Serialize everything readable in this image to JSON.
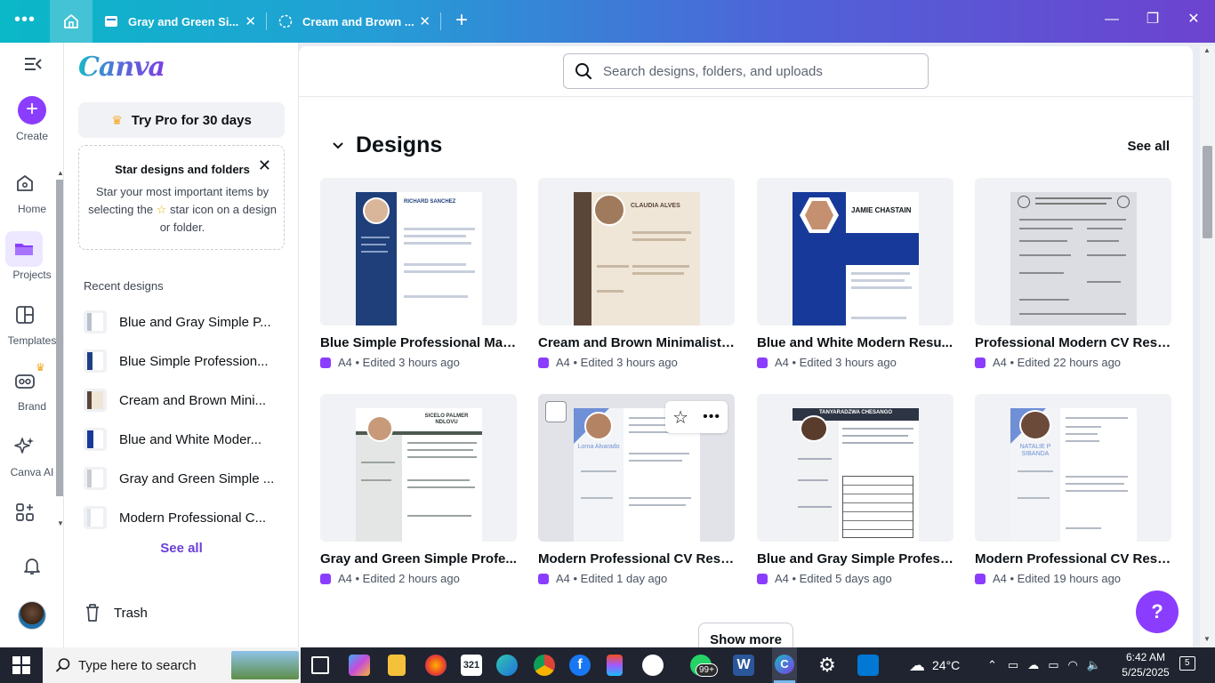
{
  "browser": {
    "tabs": [
      {
        "label": "Gray and Green Si..."
      },
      {
        "label": "Cream and Brown ..."
      }
    ]
  },
  "rail": {
    "create": "Create",
    "home": "Home",
    "projects": "Projects",
    "templates": "Templates",
    "brand": "Brand",
    "canva_ai": "Canva AI"
  },
  "panel": {
    "logo": "Canva",
    "pro_button": "Try Pro for 30 days",
    "star_card": {
      "title": "Star designs and folders",
      "body_before": "Star your most important items by selecting the",
      "body_after": "star icon on a design or folder."
    },
    "recent_title": "Recent designs",
    "recent": [
      {
        "label": "Blue and Gray Simple P..."
      },
      {
        "label": "Blue Simple Profession..."
      },
      {
        "label": "Cream and Brown Mini..."
      },
      {
        "label": "Blue and White Moder..."
      },
      {
        "label": "Gray and Green Simple ..."
      },
      {
        "label": "Modern Professional C..."
      }
    ],
    "see_all": "See all",
    "trash": "Trash"
  },
  "main": {
    "search_placeholder": "Search designs, folders, and uploads",
    "section_title": "Designs",
    "see_all": "See all",
    "designs": [
      {
        "title": "Blue Simple Professional Mar...",
        "meta": "A4 • Edited 3 hours ago",
        "thumb_name": "richard-sanchez-resume",
        "thumb_heading": "RICHARD SANCHEZ"
      },
      {
        "title": "Cream and Brown Minimalist ...",
        "meta": "A4 • Edited 3 hours ago",
        "thumb_name": "claudia-alves-resume",
        "thumb_heading": "CLAUDIA ALVES"
      },
      {
        "title": "Blue and White Modern Resu...",
        "meta": "A4 • Edited 3 hours ago",
        "thumb_name": "jamie-chastain-resume",
        "thumb_heading": "JAMIE CHASTAIN"
      },
      {
        "title": "Professional Modern CV Resu...",
        "meta": "A4 • Edited 22 hours ago",
        "thumb_name": "scanned-document",
        "thumb_heading": ""
      },
      {
        "title": "Gray and Green Simple Profe...",
        "meta": "A4 • Edited 2 hours ago",
        "thumb_name": "sicelo-palmer-resume",
        "thumb_heading": "SICELO PALMER NDLOVU"
      },
      {
        "title": "Modern Professional CV Resu...",
        "meta": "A4 • Edited 1 day ago",
        "thumb_name": "lorna-alvarado-resume",
        "thumb_heading": "Lorna Alvarado"
      },
      {
        "title": "Blue and Gray Simple Profess...",
        "meta": "A4 • Edited 5 days ago",
        "thumb_name": "tanyaradzwa-chesango-resume",
        "thumb_heading": "TANYARADZWA CHESANGO"
      },
      {
        "title": "Modern Professional CV Resu...",
        "meta": "A4 • Edited 19 hours ago",
        "thumb_name": "natalie-sibanda-resume",
        "thumb_heading": "NATALIE P SIBANDA"
      }
    ],
    "show_more": "Show more",
    "help": "?"
  },
  "taskbar": {
    "search_placeholder": "Type here to search",
    "weather": "24°C",
    "time": "6:42 AM",
    "date": "5/25/2025",
    "notif_badge": "99+",
    "notif_count": "5"
  },
  "colors": {
    "accent": "#8b3dff",
    "titlebar_start": "#0ab8c7",
    "titlebar_end": "#6d43cf"
  }
}
